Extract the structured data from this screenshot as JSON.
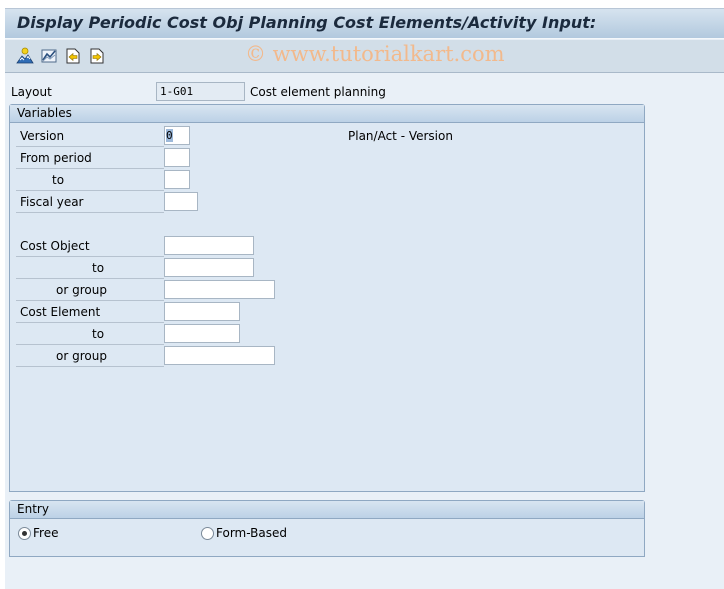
{
  "window": {
    "title": "Display Periodic Cost Obj Planning Cost Elements/Activity Input:"
  },
  "toolbar": {
    "buttons": [
      {
        "icon": "person-mountain-icon",
        "tooltip": "Master data"
      },
      {
        "icon": "line-chart-icon",
        "tooltip": "Graphic"
      },
      {
        "icon": "previous-page-icon",
        "tooltip": "Previous"
      },
      {
        "icon": "next-page-icon",
        "tooltip": "Next"
      }
    ],
    "watermark": "© www.tutorialkart.com"
  },
  "layout": {
    "label": "Layout",
    "value": "1-G01",
    "description": "Cost element planning"
  },
  "variables": {
    "title": "Variables",
    "version": {
      "label": "Version",
      "value": "0",
      "description": "Plan/Act - Version"
    },
    "from_period": {
      "label": "From period",
      "value": ""
    },
    "to_period": {
      "label": "to",
      "value": ""
    },
    "fiscal_year": {
      "label": "Fiscal year",
      "value": ""
    },
    "cost_object": {
      "label": "Cost Object",
      "value": ""
    },
    "cost_object_to": {
      "label": "to",
      "value": ""
    },
    "cost_object_group": {
      "label": "or group",
      "value": ""
    },
    "cost_element": {
      "label": "Cost Element",
      "value": ""
    },
    "cost_element_to": {
      "label": "to",
      "value": ""
    },
    "cost_element_group": {
      "label": "or group",
      "value": ""
    }
  },
  "entry": {
    "title": "Entry",
    "options": [
      {
        "label": "Free",
        "selected": true
      },
      {
        "label": "Form-Based",
        "selected": false
      }
    ]
  }
}
